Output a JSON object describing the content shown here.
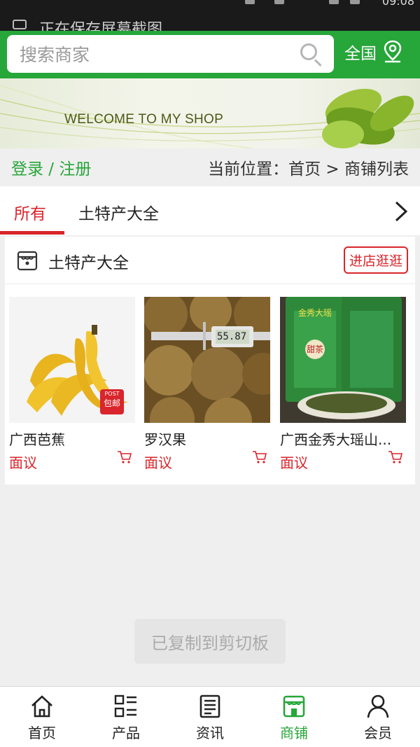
{
  "status_bar": {
    "notice": "正在保存屏幕截图",
    "time": "09:08"
  },
  "header": {
    "search_placeholder": "搜索商家",
    "region_label": "全国"
  },
  "banner": {
    "welcome_text": "WELCOME TO MY SHOP"
  },
  "crumbbar": {
    "login_register": "登录 / 注册",
    "location": "当前位置：首页 > 商铺列表"
  },
  "tabs": [
    {
      "label": "所有",
      "active": true
    },
    {
      "label": "土特产大全",
      "active": false
    }
  ],
  "shop_card": {
    "shop_name": "土特产大全",
    "visit_button": "进店逛逛",
    "products": [
      {
        "name": "广西芭蕉",
        "price": "面议",
        "badge_top": "POST",
        "badge_bottom": "包邮"
      },
      {
        "name": "罗汉果",
        "price": "面议",
        "caliper_reading": "55.87"
      },
      {
        "name": "广西金秀大瑶山...",
        "price": "面议",
        "package_text": "金秀大瑶",
        "package_subtext": "甜茶"
      }
    ]
  },
  "toast": {
    "message": "已复制到剪切板"
  },
  "bottom_nav": [
    {
      "label": "首页",
      "icon": "home-icon",
      "active": false
    },
    {
      "label": "产品",
      "icon": "grid-list-icon",
      "active": false
    },
    {
      "label": "资讯",
      "icon": "news-icon",
      "active": false
    },
    {
      "label": "商铺",
      "icon": "shop-icon",
      "active": true
    },
    {
      "label": "会员",
      "icon": "user-icon",
      "active": false
    }
  ],
  "colors": {
    "brand_green": "#27a63a",
    "accent_red": "#d9252b"
  }
}
